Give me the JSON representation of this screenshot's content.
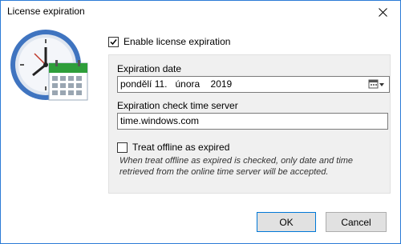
{
  "window": {
    "title": "License expiration"
  },
  "enable_expiration": {
    "label": "Enable license expiration",
    "checked": true
  },
  "expiration_date": {
    "label": "Expiration date",
    "value": "pondělí 11.   února    2019"
  },
  "time_server": {
    "label": "Expiration check time server",
    "value": "time.windows.com"
  },
  "treat_offline": {
    "label": "Treat offline as expired",
    "checked": false,
    "note": "When treat offline as expired is checked, only date and time retrieved from the online time server will be accepted."
  },
  "buttons": {
    "ok": "OK",
    "cancel": "Cancel"
  },
  "icons": [
    "close-icon",
    "clock-calendar-icon",
    "calendar-dropdown-icon"
  ],
  "colors": {
    "accent": "#0078d7",
    "calendar_green": "#2e9e3a"
  }
}
